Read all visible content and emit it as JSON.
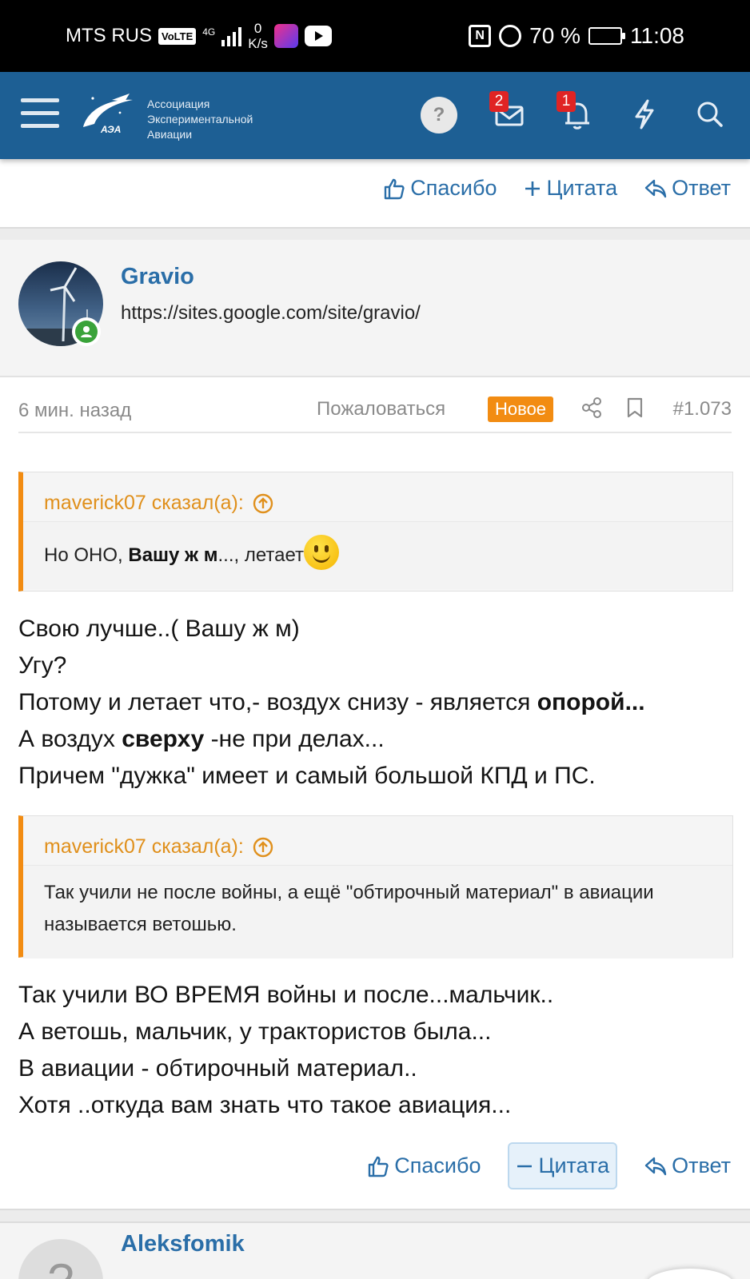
{
  "status_bar": {
    "carrier": "MTS RUS",
    "volte": "VoLTE",
    "network": "4G",
    "speed_value": "0",
    "speed_unit": "K/s",
    "battery": "70 %",
    "time": "11:08",
    "battery_level": 0.7
  },
  "navbar": {
    "logo_abbr": "АЭА",
    "logo_line1": "Ассоциация",
    "logo_line2": "Экспериментальной",
    "logo_line3": "Авиации",
    "help_label": "?",
    "inbox_badge": "2",
    "alerts_badge": "1",
    "icons": [
      "menu-icon",
      "help-icon",
      "inbox-icon",
      "bell-icon",
      "lightning-icon",
      "search-icon"
    ],
    "bg_color": "#1d5f94"
  },
  "prev_post_actions": {
    "like": "Спасибо",
    "quote": "Цитата",
    "reply": "Ответ"
  },
  "post": {
    "username": "Gravio",
    "user_title": "https://sites.google.com/site/gravio/",
    "time": "6 мин. назад",
    "report": "Пожаловаться",
    "new_badge": "Новое",
    "post_number": "#1.073",
    "quote1": {
      "author": "maverick07 сказал(а):",
      "text_before": "Но ОНО, ",
      "text_bold": "Вашу ж м",
      "text_after": "..., летает"
    },
    "body1": {
      "line1": "Свою лучше..( Вашу ж м)",
      "line2": "Угу?",
      "line3_before": "Потому и летает что,- воздух снизу - является ",
      "line3_bold": "опорой...",
      "line4_before": "А воздух ",
      "line4_bold": "сверху",
      "line4_after": " -не при делах...",
      "line5": "Причем \"дужка\" имеет и самый большой КПД и ПС."
    },
    "quote2": {
      "author": "maverick07 сказал(а):",
      "text": "Так учили не после войны, а ещё \"обтирочный материал\" в авиации называется ветошью."
    },
    "body2": {
      "line1": "Так учили ВО ВРЕМЯ войны и после...мальчик..",
      "line2": "А ветошь, мальчик, у трактористов была...",
      "line3": "В авиации - обтирочный материал..",
      "line4": "Хотя ..откуда вам знать что такое авиация..."
    },
    "actions": {
      "like": "Спасибо",
      "quote": "Цитата",
      "reply": "Ответ"
    },
    "accent_color": "#f28c12",
    "link_color": "#2a6ea8"
  },
  "next_post": {
    "username": "Aleksfomik",
    "avatar_placeholder": "?"
  }
}
